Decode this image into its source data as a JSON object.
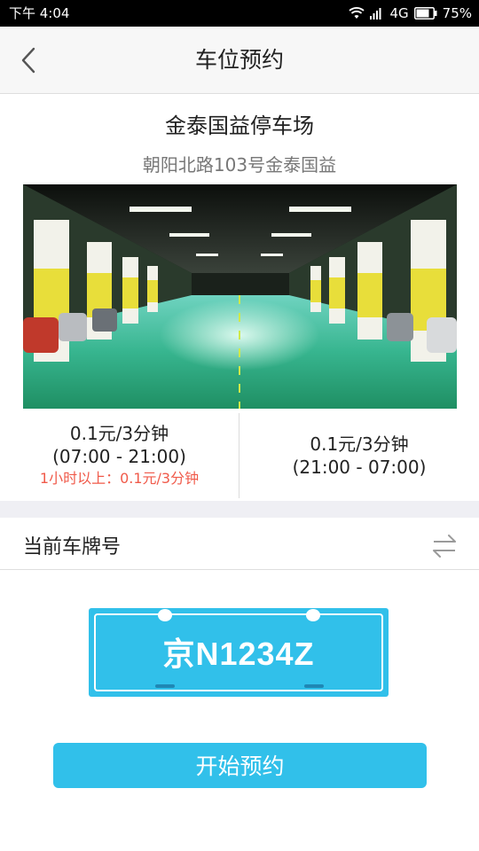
{
  "status_bar": {
    "time": "下午 4:04",
    "network": "4G",
    "battery": "75%",
    "icons": [
      "wifi-icon",
      "signal-icon",
      "battery-icon"
    ]
  },
  "nav": {
    "title": "车位预约",
    "back_icon": "chevron-left-icon"
  },
  "lot": {
    "name": "金泰国益停车场",
    "address": "朝阳北路103号金泰国益"
  },
  "rates": {
    "day": {
      "price": "0.1元/3分钟",
      "hours": "(07:00 - 21:00)",
      "note": "1小时以上：0.1元/3分钟"
    },
    "night": {
      "price": "0.1元/3分钟",
      "hours": "(21:00 - 07:00)"
    }
  },
  "plate": {
    "label": "当前车牌号",
    "number": "京N1234Z",
    "swap_icon": "swap-arrows-icon"
  },
  "action": {
    "submit_label": "开始预约"
  },
  "colors": {
    "accent": "#31c0ea",
    "note_red": "#f05a4a",
    "divider": "#dedede",
    "section_gap": "#efeff4"
  }
}
